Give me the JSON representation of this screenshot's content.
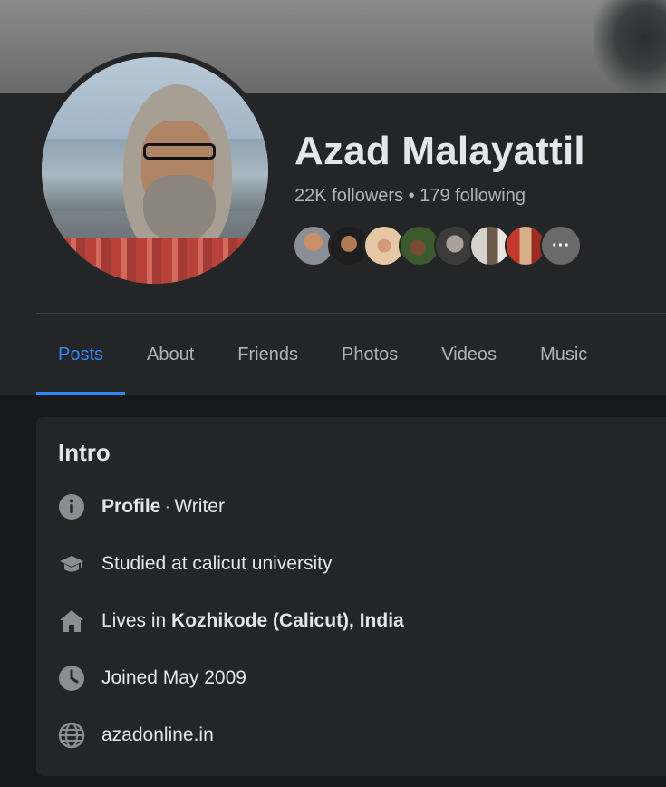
{
  "profile": {
    "name": "Azad Malayattil",
    "followers": "22K followers",
    "dot": "•",
    "following": "179 following",
    "friends_more": "···"
  },
  "tabs": [
    "Posts",
    "About",
    "Friends",
    "Photos",
    "Videos",
    "Music"
  ],
  "intro": {
    "title": "Intro",
    "profile_label": "Profile",
    "profile_sep": "·",
    "profile_value": "Writer",
    "education": "Studied at calicut university",
    "lives_prefix": "Lives in",
    "lives_place": "Kozhikode (Calicut), India",
    "joined": "Joined May 2009",
    "website": "azadonline.in"
  },
  "colors": {
    "accent": "#2d88ff",
    "background": "#18191a",
    "card": "#242526",
    "secondary_text": "#b0b3b8"
  },
  "icons": [
    "info-icon",
    "graduation-cap-icon",
    "home-icon",
    "clock-icon",
    "globe-icon"
  ]
}
